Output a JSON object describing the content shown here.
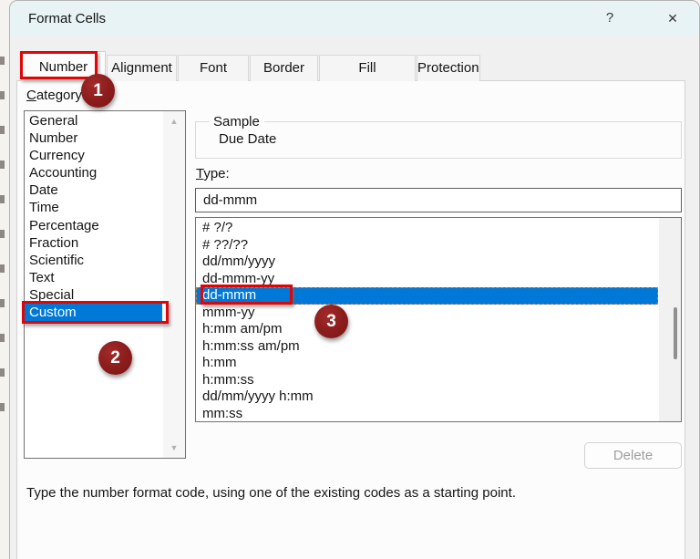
{
  "window": {
    "title": "Format Cells",
    "help_icon": "?",
    "close_icon": "✕"
  },
  "tabs": {
    "items": [
      "Number",
      "Alignment",
      "Font",
      "Border",
      "Fill",
      "Protection"
    ],
    "selected": "Number"
  },
  "category": {
    "label": "Category:",
    "items": [
      "General",
      "Number",
      "Currency",
      "Accounting",
      "Date",
      "Time",
      "Percentage",
      "Fraction",
      "Scientific",
      "Text",
      "Special",
      "Custom"
    ],
    "selected": "Custom",
    "scroll_up_icon": "▲",
    "scroll_down_icon": "▼"
  },
  "sample": {
    "label": "Sample",
    "value": "Due Date"
  },
  "type": {
    "label": "Type:",
    "value": "dd-mmm",
    "items": [
      "# ?/?",
      "# ??/??",
      "dd/mm/yyyy",
      "dd-mmm-yy",
      "dd-mmm",
      "mmm-yy",
      "h:mm am/pm",
      "h:mm:ss am/pm",
      "h:mm",
      "h:mm:ss",
      "dd/mm/yyyy h:mm",
      "mm:ss"
    ],
    "selected": "dd-mmm"
  },
  "buttons": {
    "delete_label": "Delete"
  },
  "help_text": "Type the number format code, using one of the existing codes as a starting point.",
  "annotations": {
    "badge1": "1",
    "badge2": "2",
    "badge3": "3"
  },
  "colors": {
    "annotation_red": "#e10505",
    "badge_maroon": "#8b1c1c",
    "selection_blue": "#0078d7",
    "titlebar_tint": "#e7f3f4"
  }
}
